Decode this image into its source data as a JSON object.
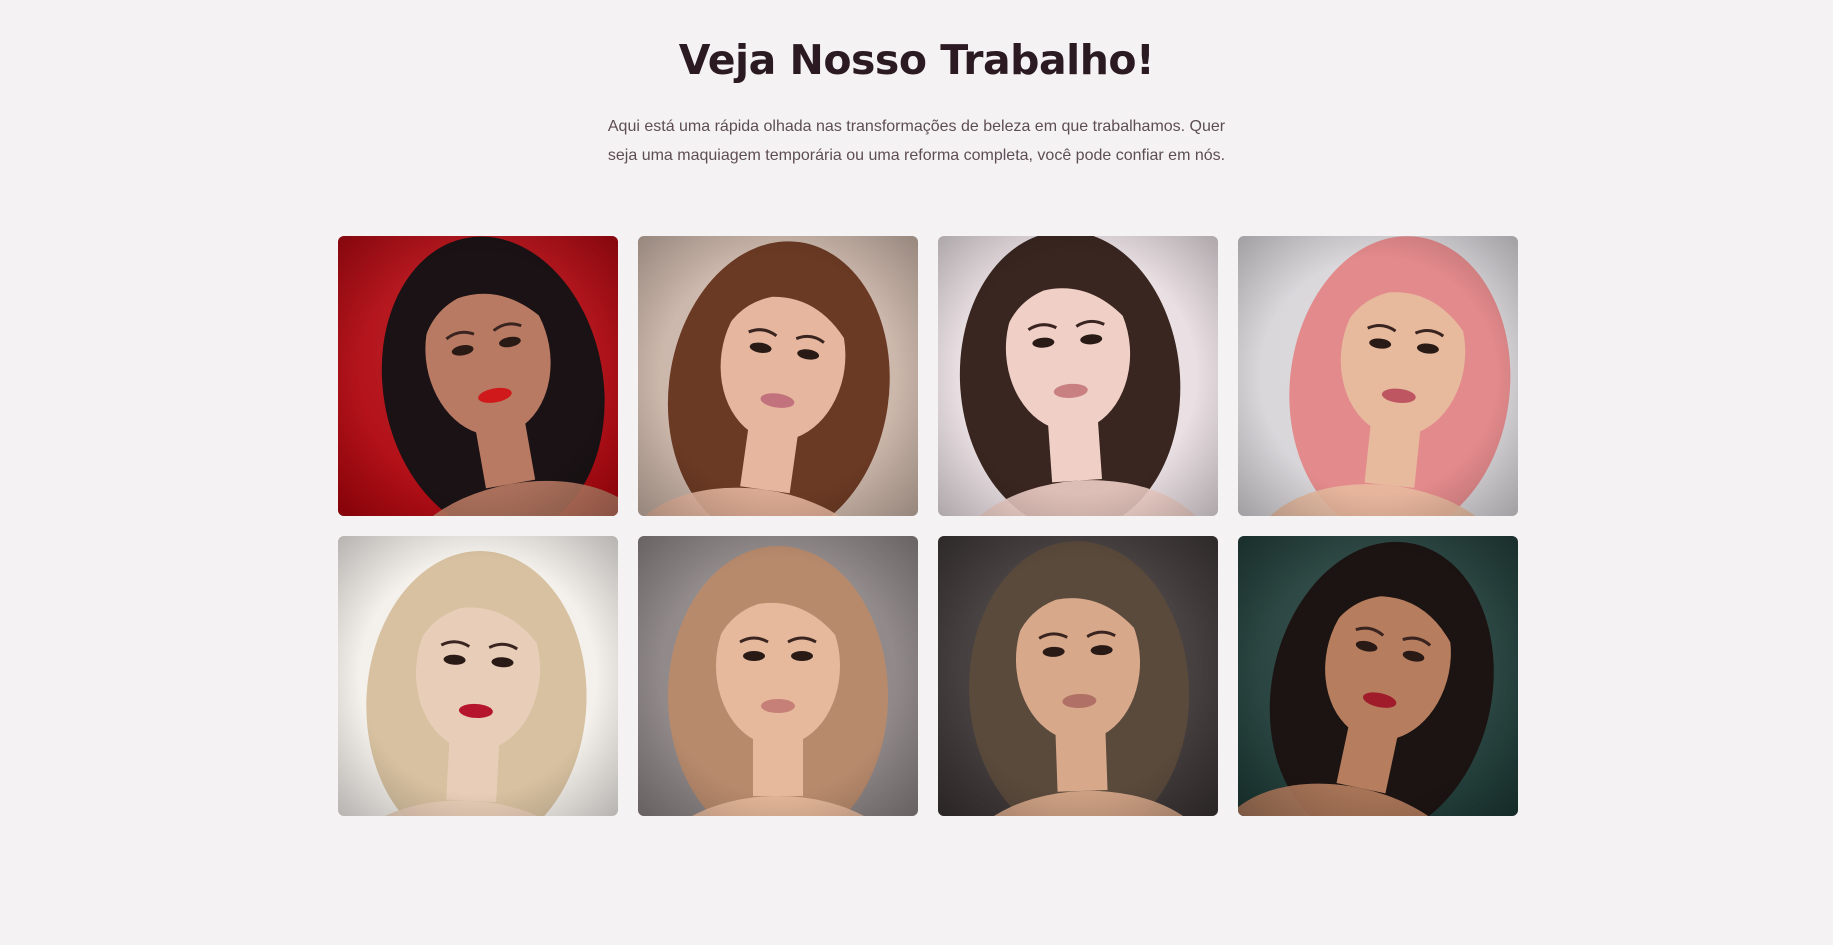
{
  "section": {
    "title": "Veja Nosso Trabalho!",
    "subtitle": "Aqui está uma rápida olhada nas transformações de beleza em que trabalhamos. Quer seja uma maquiagem temporária ou uma reforma completa, você pode confiar em nós."
  },
  "gallery": {
    "photos": [
      {
        "label": "portrait-red-background",
        "bg": "#b0050d",
        "hair": "#1a1214",
        "skin": "#b97a63",
        "lips": "#d0191a"
      },
      {
        "label": "portrait-floral-bokeh",
        "bg": "#c9b3a6",
        "hair": "#6b3a24",
        "skin": "#e6b69f",
        "lips": "#c2727c"
      },
      {
        "label": "portrait-window-light",
        "bg": "#e9dfe3",
        "hair": "#3a2620",
        "skin": "#efcfc6",
        "lips": "#c88080"
      },
      {
        "label": "portrait-pink-hair",
        "bg": "#d7d5d8",
        "hair": "#e38a8c",
        "skin": "#e7b99d",
        "lips": "#bd5661"
      },
      {
        "label": "portrait-blonde-bob",
        "bg": "#f4f1ec",
        "hair": "#d7c1a0",
        "skin": "#e8cdb8",
        "lips": "#b5162e"
      },
      {
        "label": "portrait-orchid-crown",
        "bg": "#8a8282",
        "hair": "#b88a6c",
        "skin": "#e7b99c",
        "lips": "#c68078"
      },
      {
        "label": "portrait-anthurium",
        "bg": "#3a3333",
        "hair": "#5a4a3c",
        "skin": "#d8a88a",
        "lips": "#b07065"
      },
      {
        "label": "portrait-fur-coat",
        "bg": "#1d3a36",
        "hair": "#1c1412",
        "skin": "#b67d5e",
        "lips": "#a01c2a"
      }
    ]
  }
}
